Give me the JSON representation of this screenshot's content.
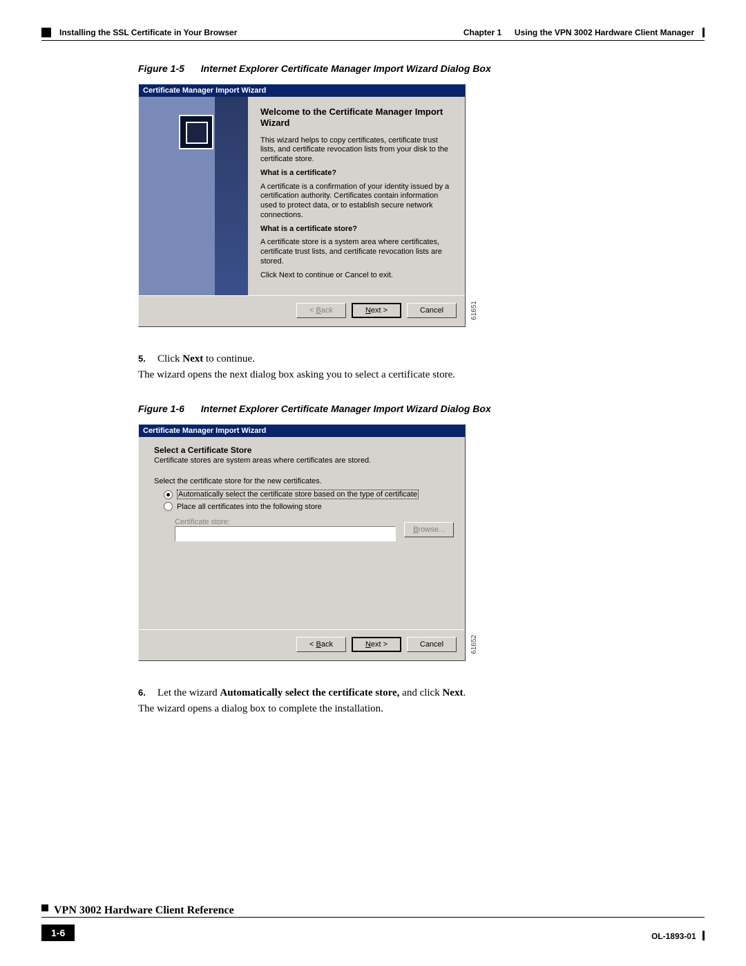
{
  "header": {
    "chapter": "Chapter 1",
    "chapter_title": "Using the VPN 3002 Hardware Client Manager",
    "section": "Installing the SSL Certificate in Your Browser"
  },
  "figure1": {
    "label": "Figure 1-5",
    "title": "Internet Explorer Certificate Manager Import Wizard Dialog Box",
    "sidelabel": "61651",
    "dialog": {
      "titlebar": "Certificate Manager Import Wizard",
      "welcome_title": "Welcome to the Certificate Manager Import Wizard",
      "intro": "This wizard helps to copy certificates, certificate trust lists, and certificate revocation lists from your disk to the certificate store.",
      "q1": "What is a certificate?",
      "a1": "A certificate is a confirmation of your identity issued by a certification authority. Certificates contain information used to protect data, or to establish secure network connections.",
      "q2": "What is a certificate store?",
      "a2": "A certificate store is a system area where certificates, certificate trust lists, and certificate revocation lists are stored.",
      "hint": "Click Next to continue or Cancel to exit.",
      "buttons": {
        "back_pre": "< ",
        "back_key": "B",
        "back_post": "ack",
        "next_key": "N",
        "next_post": "ext >",
        "cancel": "Cancel"
      }
    }
  },
  "step5": {
    "num": "5.",
    "text_pre": "Click ",
    "text_bold": "Next",
    "text_post": " to continue."
  },
  "para1": "The wizard opens the next dialog box asking you to select a certificate store.",
  "figure2": {
    "label": "Figure 1-6",
    "title": "Internet Explorer Certificate Manager Import Wizard Dialog Box",
    "sidelabel": "61652",
    "dialog": {
      "titlebar": "Certificate Manager Import Wizard",
      "heading": "Select a Certificate Store",
      "sub": "Certificate stores are system areas where certificates are stored.",
      "instr": "Select the certificate store for the new certificates.",
      "radio1_key": "A",
      "radio1_rest": "utomatically select the certificate store based on the type of certificate",
      "radio2_key": "P",
      "radio2_rest": "lace all certificates into the following store",
      "store_label": "Certificate store:",
      "browse_key": "B",
      "browse_rest": "rowse...",
      "buttons": {
        "back_pre": "< ",
        "back_key": "B",
        "back_post": "ack",
        "next_key": "N",
        "next_post": "ext >",
        "cancel": "Cancel"
      }
    }
  },
  "step6": {
    "num": "6.",
    "pre": "Let the wizard ",
    "bold": "Automatically select the certificate store,",
    "mid": " and click ",
    "bold2": "Next",
    "post": "."
  },
  "para2": "The wizard opens a dialog box to complete the installation.",
  "footer": {
    "title": "VPN 3002 Hardware Client Reference",
    "page": "1-6",
    "doc": "OL-1893-01"
  }
}
